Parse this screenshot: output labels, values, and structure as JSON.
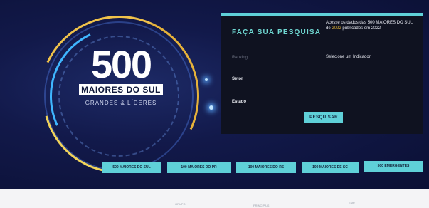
{
  "hero": {
    "logo_number": "500",
    "logo_band": "MAIORES DO SUL",
    "logo_sub": "GRANDES & LÍDERES"
  },
  "search_panel": {
    "title": "FAÇA SUA PESQUISA",
    "note_prefix": "Acesse os dados das 500 MAIORES DO SUL de",
    "note_highlight": "2022",
    "note_suffix": "publicados em 2022",
    "indicator_label": "Selecione um Indicador",
    "field_1": "Ranking",
    "field_2": "Setor",
    "field_3": "Estado",
    "button": "PESQUISAR"
  },
  "rank_buttons": [
    "500 MAIORES DO SUL",
    "100 MAIORES DO PR",
    "100 MAIORES DO RS",
    "100 MAIORES DE SC",
    "500 EMERGENTES"
  ],
  "lower": {
    "text_1": "GRUPO",
    "text_2": "PRINCIPAIS",
    "text_3": "EMP."
  },
  "colors": {
    "accent": "#5fd0d8",
    "panel_bg": "#0f1220",
    "hero_bg": "#12194a",
    "highlight": "#e0b43a"
  }
}
